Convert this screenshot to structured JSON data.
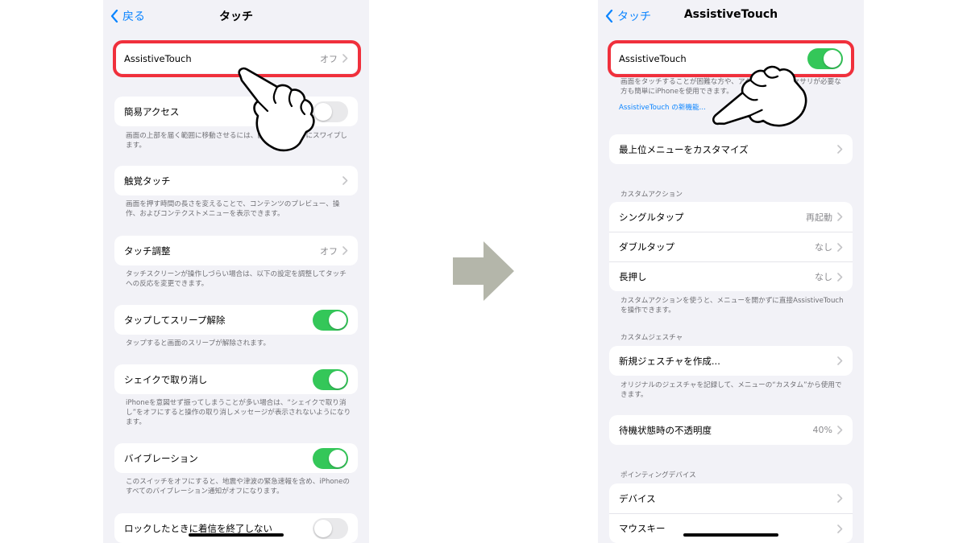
{
  "left": {
    "nav": {
      "back_label": "戻る",
      "title": "タッチ"
    },
    "rows": {
      "assistive": {
        "label": "AssistiveTouch",
        "value": "オフ"
      },
      "reach": {
        "label": "簡易アクセス",
        "footer": "画面の上部を届く範囲に移動させるには、画面の下端を下にスワイプします。"
      },
      "haptic": {
        "label": "触覚タッチ",
        "footer": "画面を押す時間の長さを変えることで、コンテンツのプレビュー、操作、およびコンテクストメニューを表示できます。"
      },
      "accommodations": {
        "label": "タッチ調整",
        "value": "オフ",
        "footer": "タッチスクリーンが操作しづらい場合は、以下の設定を調整してタッチへの反応を変更できます。"
      },
      "tap_wake": {
        "label": "タップしてスリープ解除",
        "footer": "タップすると画面のスリープが解除されます。"
      },
      "shake_undo": {
        "label": "シェイクで取り消し",
        "footer": "iPhoneを意図せず振ってしまうことが多い場合は、“シェイクで取り消し”をオフにすると操作の取り消しメッセージが表示されないようになります。"
      },
      "vibration": {
        "label": "バイブレーション",
        "footer": "このスイッチをオフにすると、地震や津波の緊急速報を含め、iPhoneのすべてのバイブレーション通知がオフになります。"
      },
      "lock_call": {
        "label": "ロックしたときに着信を終了しない"
      }
    }
  },
  "right": {
    "nav": {
      "back_label": "タッチ",
      "title": "AssistiveTouch"
    },
    "assistive": {
      "label": "AssistiveTouch",
      "footer": "画面をタッチすることが困難な方や、アダプティブアクセサリが必要な方も簡単にiPhoneを使用できます。",
      "link": "AssistiveTouch の新機能..."
    },
    "customize": {
      "label": "最上位メニューをカスタマイズ"
    },
    "custom_actions": {
      "header": "カスタムアクション",
      "single": {
        "label": "シングルタップ",
        "value": "再起動"
      },
      "double": {
        "label": "ダブルタップ",
        "value": "なし"
      },
      "long": {
        "label": "長押し",
        "value": "なし"
      },
      "footer": "カスタムアクションを使うと、メニューを開かずに直接AssistiveTouchを操作できます。"
    },
    "custom_gestures": {
      "header": "カスタムジェスチャ",
      "create": {
        "label": "新規ジェスチャを作成..."
      },
      "footer": "オリジナルのジェスチャを記録して、メニューの“カスタム”から使用できます。"
    },
    "opacity": {
      "label": "待機状態時の不透明度",
      "value": "40%"
    },
    "pointing": {
      "header": "ポインティングデバイス",
      "devices": {
        "label": "デバイス"
      },
      "mouse_keys": {
        "label": "マウスキー"
      }
    }
  },
  "toggles": {
    "left_reach": false,
    "left_tap_wake": true,
    "left_shake_undo": true,
    "left_vibration": true,
    "left_lock_call": false,
    "right_assistive": true
  },
  "colors": {
    "background": "#f2f2f7",
    "accent": "#0a84ff",
    "toggle_on": "#34c759",
    "highlight": "#f0303c",
    "arrow": "#b4b6aa"
  },
  "icons": [
    "chevron-left-icon",
    "chevron-right-icon",
    "pointing-hand-icon",
    "arrow-right-icon"
  ]
}
